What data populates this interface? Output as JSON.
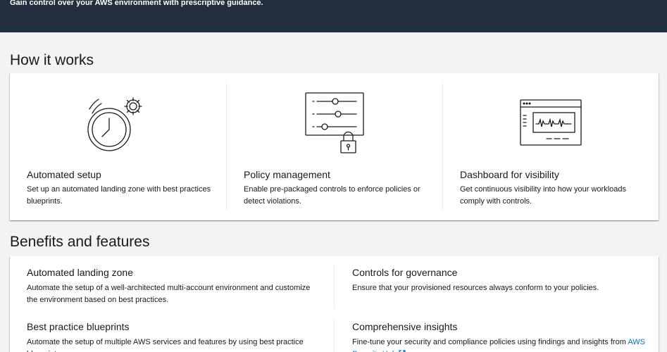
{
  "hero": {
    "tagline": "Gain control over your AWS environment with prescriptive guidance."
  },
  "how_it_works": {
    "title": "How it works",
    "steps": [
      {
        "title": "Automated setup",
        "description": "Set up an automated landing zone with best practices blueprints.",
        "icon": "clock-gear-icon"
      },
      {
        "title": "Policy management",
        "description": "Enable pre-packaged controls to enforce policies or detect violations.",
        "icon": "policy-sliders-lock-icon"
      },
      {
        "title": "Dashboard for visibility",
        "description": "Get continuous visibility into how your workloads comply with controls.",
        "icon": "dashboard-window-icon"
      }
    ]
  },
  "benefits": {
    "title": "Benefits and features",
    "items": [
      {
        "title": "Automated landing zone",
        "description": "Automate the setup of a well-architected multi-account environment and customize the environment based on best practices."
      },
      {
        "title": "Controls for governance",
        "description": "Ensure that your provisioned resources always conform to your policies."
      },
      {
        "title": "Best practice blueprints",
        "description": "Automate the setup of multiple AWS services and features by using best practice blueprints."
      },
      {
        "title": "Comprehensive insights",
        "description": "Fine-tune your security and compliance policies using findings and insights from",
        "link_text": "AWS Security Hub"
      }
    ]
  },
  "colors": {
    "hero_bg": "#232f3e",
    "page_bg": "#f2f3f3",
    "card_bg": "#ffffff",
    "text": "#16191f",
    "link": "#0073bb"
  }
}
